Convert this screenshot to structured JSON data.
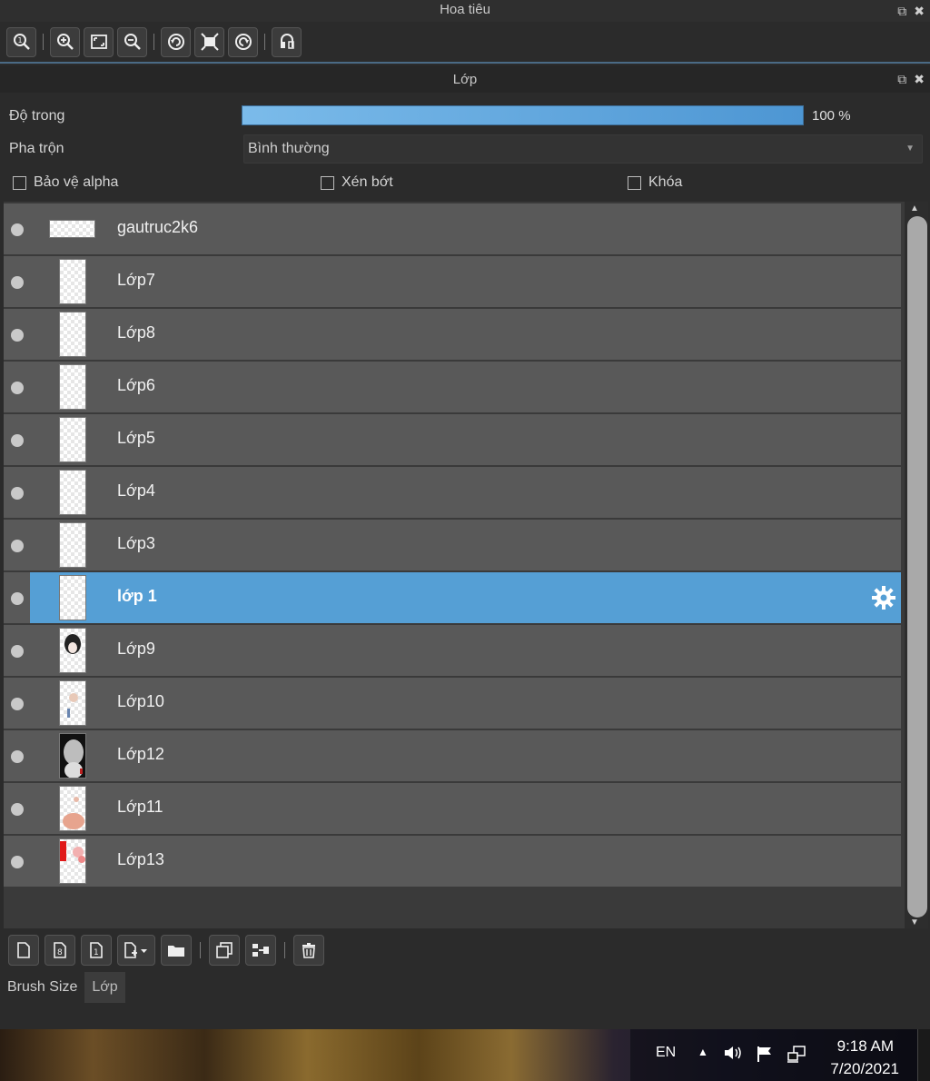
{
  "navigator": {
    "title": "Hoa tiêu",
    "toolbar_icons": [
      "zoom-actual-icon",
      "zoom-in-icon",
      "fit-window-icon",
      "zoom-out-icon",
      "rotate-left-icon",
      "fit-screen-icon",
      "rotate-right-icon",
      "flip-icon"
    ]
  },
  "layer_panel": {
    "title": "Lớp",
    "opacity_label": "Độ trong",
    "opacity_value": "100 %",
    "opacity_fraction": 1.0,
    "blend_label": "Pha trộn",
    "blend_value": "Bình thường",
    "checkboxes": {
      "protect_alpha": "Bảo vệ alpha",
      "clipping": "Xén bớt",
      "lock": "Khóa"
    },
    "layers": [
      {
        "name": "gautruc2k6",
        "selected": false
      },
      {
        "name": "Lớp7",
        "selected": false
      },
      {
        "name": "Lớp8",
        "selected": false
      },
      {
        "name": "Lớp6",
        "selected": false
      },
      {
        "name": "Lớp5",
        "selected": false
      },
      {
        "name": "Lớp4",
        "selected": false
      },
      {
        "name": "Lớp3",
        "selected": false
      },
      {
        "name": "lớp 1",
        "selected": true
      },
      {
        "name": "Lớp9",
        "selected": false
      },
      {
        "name": "Lớp10",
        "selected": false
      },
      {
        "name": "Lớp12",
        "selected": false
      },
      {
        "name": "Lớp11",
        "selected": false
      },
      {
        "name": "Lớp13",
        "selected": false
      }
    ]
  },
  "tabs": [
    "Brush Size",
    "Lớp"
  ],
  "taskbar": {
    "language": "EN",
    "time": "9:18 AM",
    "date": "7/20/2021"
  },
  "colors": {
    "selected_row": "#559fd5",
    "row": "#595959",
    "opacity_bar": "#5aa3db"
  }
}
